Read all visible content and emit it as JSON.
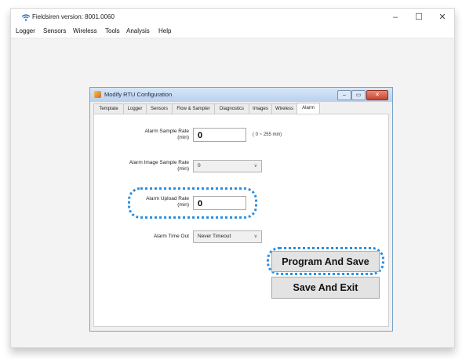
{
  "window": {
    "title": "Fieldsiren version: 8001.0060",
    "controls": {
      "minimize": "–",
      "maximize": "☐",
      "close": "✕"
    }
  },
  "menubar": {
    "items": [
      "Logger",
      "Sensors",
      "Wireless",
      "Tools",
      "Analysis",
      "Help"
    ]
  },
  "dialog": {
    "title": "Modify RTU Configuration",
    "controls": {
      "minimize": "–",
      "maximize": "▭",
      "close": "✕"
    },
    "tabs": [
      "Template",
      "Logger",
      "Sensors",
      "Flow & Sampler",
      "Diagnostics",
      "Images",
      "Wireless",
      "Alarm"
    ],
    "active_tab": "Alarm",
    "alarm_sample_rate": {
      "label": "Alarm Sample Rate",
      "unit": "(min)",
      "value": "0",
      "hint": "( 0 ~ 255 min)"
    },
    "alarm_image_sample_rate": {
      "label": "Alarm Image Sample Rate",
      "unit": "(min)",
      "value": "0"
    },
    "alarm_upload_rate": {
      "label": "Alarm Upload Rate",
      "unit": "(min)",
      "value": "0"
    },
    "alarm_time_out": {
      "label": "Alarm Time Out",
      "value": "Never Timeout"
    },
    "buttons": {
      "program_and_save": "Program And Save",
      "save_and_exit": "Save And Exit"
    }
  },
  "colors": {
    "highlight": "#2b8fe0"
  }
}
